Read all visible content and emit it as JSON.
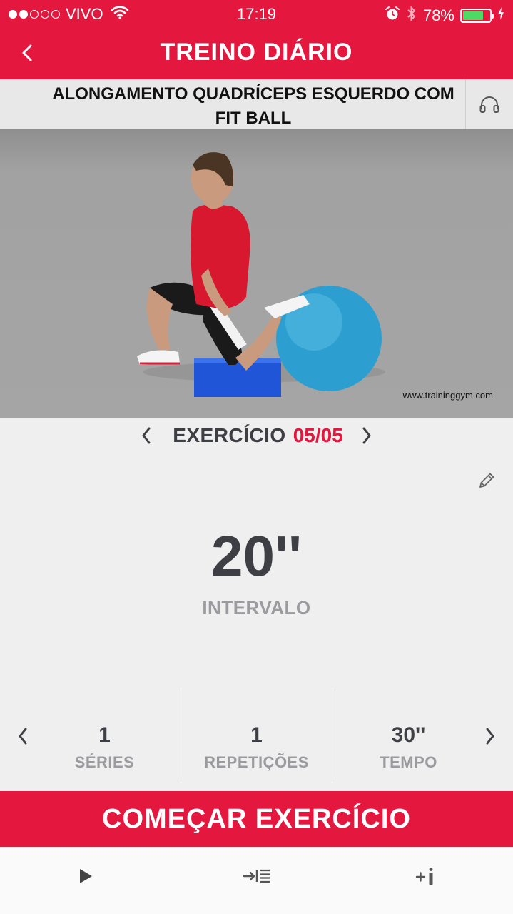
{
  "status_bar": {
    "carrier": "VIVO",
    "time": "17:19",
    "battery": "78%",
    "battery_level": 0.78
  },
  "nav": {
    "title": "TREINO DIÁRIO",
    "back_icon": "chevron-left-icon"
  },
  "exercise": {
    "title": "ALONGAMENTO QUADRÍCEPS ESQUERDO COM FIT BALL",
    "audio_icon": "headphones-icon",
    "watermark": "www.traininggym.com"
  },
  "exercise_nav": {
    "label": "EXERCÍCIO",
    "count": "05/05"
  },
  "main": {
    "value": "20''",
    "label": "INTERVALO"
  },
  "stats": [
    {
      "value": "1",
      "label": "SÉRIES"
    },
    {
      "value": "1",
      "label": "REPETIÇÕES"
    },
    {
      "value": "30''",
      "label": "TEMPO"
    }
  ],
  "start_button": {
    "label": "COMEÇAR EXERCÍCIO"
  },
  "tab_bar": {
    "icons": [
      "play-icon",
      "indent-list-icon",
      "plus-info-icon"
    ]
  },
  "colors": {
    "brand_red": "#e4173e",
    "text_dark": "#3e3e45",
    "text_muted": "#9a9a9f",
    "background": "#efefef",
    "battery_green": "#4cd964"
  }
}
